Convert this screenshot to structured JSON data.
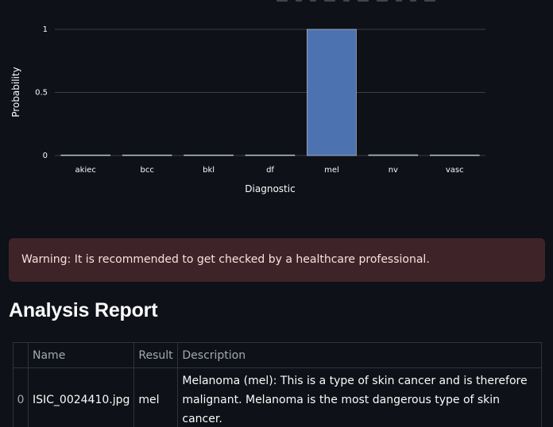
{
  "chart_data": {
    "type": "bar",
    "categories": [
      "akiec",
      "bcc",
      "bkl",
      "df",
      "mel",
      "nv",
      "vasc"
    ],
    "values": [
      0.0005,
      0.0005,
      0.0005,
      0.0005,
      1.0,
      0.006,
      0.0005
    ],
    "xlabel": "Diagnostic",
    "ylabel": "Probability",
    "ylim": [
      0,
      1
    ],
    "yticks": [
      "0",
      "0.5",
      "1"
    ],
    "grid": true,
    "colors": {
      "bar": "#4c72b0",
      "grid": "#3a3d45",
      "bar_edge": "#d8dbe2"
    }
  },
  "warning": {
    "text": "Warning: It is recommended to get checked by a healthcare professional."
  },
  "report": {
    "title": "Analysis Report",
    "columns": [
      "",
      "Name",
      "Result",
      "Description"
    ],
    "rows": [
      {
        "index": "0",
        "name": "ISIC_0024410.jpg",
        "result": "mel",
        "description": "Melanoma (mel): This is a type of skin cancer and is therefore malignant. Melanoma is the most dangerous type of skin cancer."
      }
    ]
  }
}
